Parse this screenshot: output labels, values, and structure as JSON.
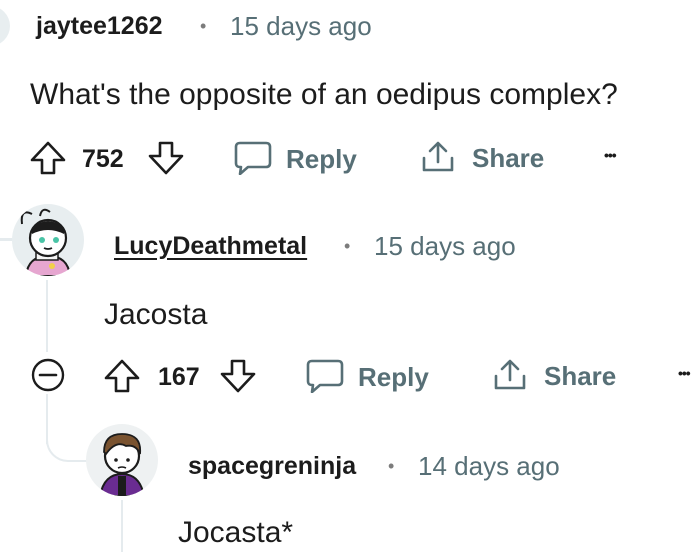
{
  "comments": [
    {
      "username": "jaytee1262",
      "separator": "•",
      "time": "15 days ago",
      "text": "What's the opposite of an oedipus complex?",
      "votes": "752",
      "reply_label": "Reply",
      "share_label": "Share",
      "more_label": "•••"
    },
    {
      "username": "LucyDeathmetal",
      "separator": "•",
      "time": "15 days ago",
      "text": "Jacosta",
      "votes": "167",
      "reply_label": "Reply",
      "share_label": "Share",
      "more_label": "•••"
    },
    {
      "username": "spacegreninja",
      "separator": "•",
      "time": "14 days ago",
      "text": "Jocasta*"
    }
  ],
  "colors": {
    "text": "#1c1c1c",
    "muted": "#576f76",
    "thread_line": "#e5ebee",
    "avatar_lucy_bg": "#e8eef0",
    "avatar_space_bg": "#eef1f2"
  }
}
